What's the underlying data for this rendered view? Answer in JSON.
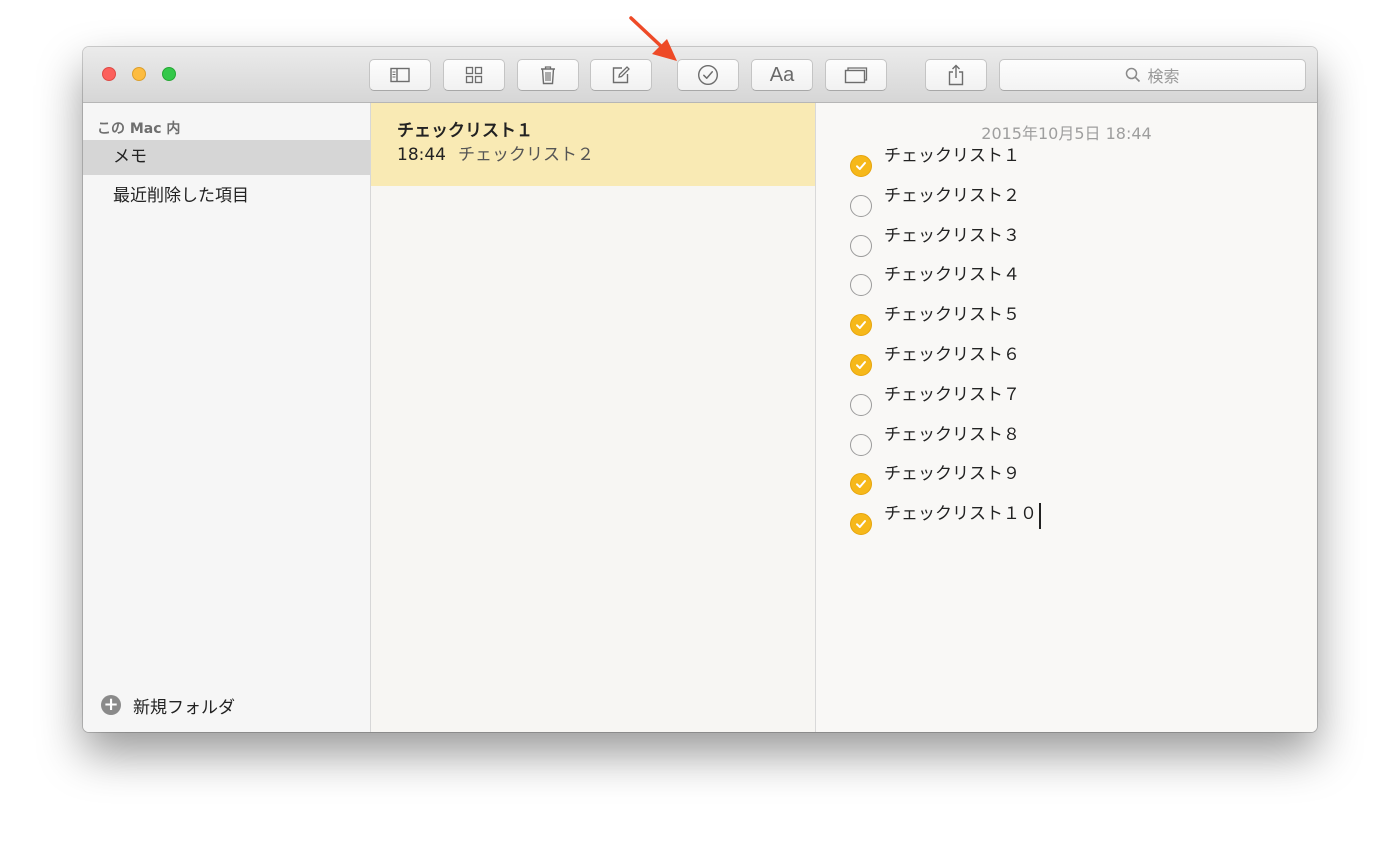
{
  "toolbar": {
    "buttons": [
      {
        "name": "sidebar-toggle",
        "icon": "sidebar-icon"
      },
      {
        "name": "gallery-view",
        "icon": "grid-icon"
      },
      {
        "name": "delete",
        "icon": "trash-icon"
      },
      {
        "name": "new-note",
        "icon": "compose-icon"
      },
      {
        "name": "checklist",
        "icon": "checkmark-circle-icon"
      },
      {
        "name": "format",
        "icon": "text-format-icon",
        "label": "Aa"
      },
      {
        "name": "attachments",
        "icon": "attachments-icon"
      },
      {
        "name": "share",
        "icon": "share-icon"
      }
    ],
    "format_label": "Aa",
    "search_placeholder": "検索"
  },
  "sidebar": {
    "heading": "この Mac 内",
    "items": [
      {
        "label": "メモ",
        "selected": true
      },
      {
        "label": "最近削除した項目",
        "selected": false
      }
    ],
    "new_folder_label": "新規フォルダ"
  },
  "notes_list": {
    "items": [
      {
        "title": "チェックリスト１",
        "time": "18:44",
        "preview": "チェックリスト２",
        "selected": true
      }
    ]
  },
  "editor": {
    "date": "2015年10月5日 18:44",
    "checklist": [
      {
        "text": "チェックリスト１",
        "checked": true
      },
      {
        "text": "チェックリスト２",
        "checked": false
      },
      {
        "text": "チェックリスト３",
        "checked": false
      },
      {
        "text": "チェックリスト４",
        "checked": false
      },
      {
        "text": "チェックリスト５",
        "checked": true
      },
      {
        "text": "チェックリスト６",
        "checked": true
      },
      {
        "text": "チェックリスト７",
        "checked": false
      },
      {
        "text": "チェックリスト８",
        "checked": false
      },
      {
        "text": "チェックリスト９",
        "checked": true
      },
      {
        "text": "チェックリスト１０",
        "checked": true
      }
    ]
  },
  "colors": {
    "selected_note_bg": "#f9eab4",
    "check_fill": "#f6b81a",
    "annotation_arrow": "#ee4a27"
  }
}
